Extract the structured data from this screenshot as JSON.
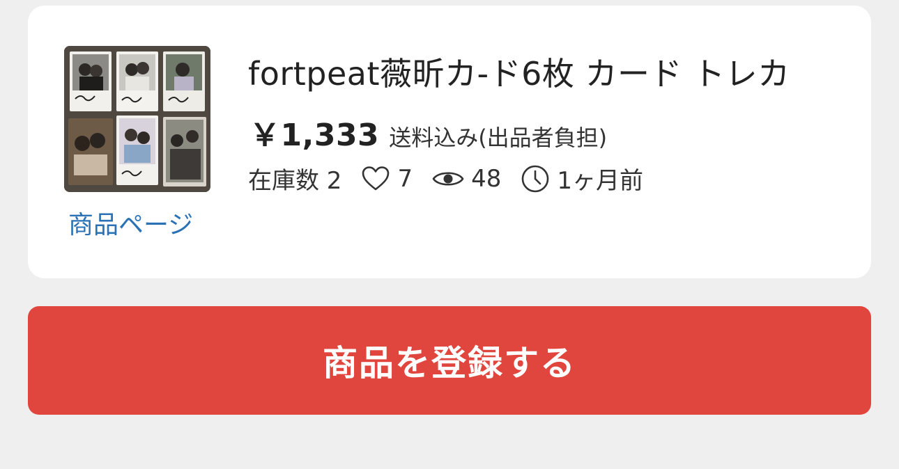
{
  "listing": {
    "title": "fortpeat薇昕カ-ド6枚 カード トレカ",
    "price": "￥1,333",
    "shipping": "送料込み(出品者負担)",
    "stock": "在庫数 2",
    "likes": "7",
    "views": "48",
    "time": "1ヶ月前",
    "product_page_link": "商品ページ"
  },
  "actions": {
    "register_label": "商品を登録する"
  },
  "colors": {
    "accent": "#e0463d",
    "link": "#2a72b5",
    "background": "#efefef"
  },
  "icons": {
    "likes": "heart-icon",
    "views": "eye-icon",
    "time": "clock-icon"
  }
}
